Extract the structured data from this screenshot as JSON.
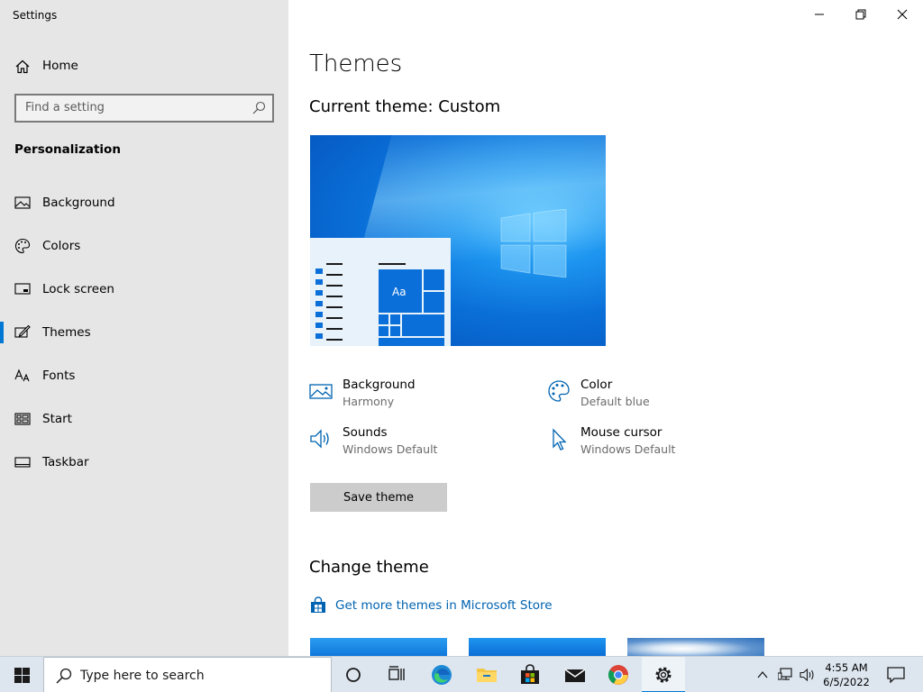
{
  "window": {
    "title": "Settings"
  },
  "sidebar": {
    "home_label": "Home",
    "search_placeholder": "Find a setting",
    "section": "Personalization",
    "items": [
      {
        "label": "Background",
        "icon": "picture-icon"
      },
      {
        "label": "Colors",
        "icon": "palette-icon"
      },
      {
        "label": "Lock screen",
        "icon": "monitor-icon"
      },
      {
        "label": "Themes",
        "icon": "pen-monitor-icon",
        "active": true
      },
      {
        "label": "Fonts",
        "icon": "font-icon"
      },
      {
        "label": "Start",
        "icon": "start-tiles-icon"
      },
      {
        "label": "Taskbar",
        "icon": "taskbar-icon"
      }
    ]
  },
  "main": {
    "title": "Themes",
    "current_theme": "Current theme: Custom",
    "properties": [
      {
        "name": "Background",
        "value": "Harmony",
        "icon": "picture-icon"
      },
      {
        "name": "Color",
        "value": "Default blue",
        "icon": "palette-icon"
      },
      {
        "name": "Sounds",
        "value": "Windows Default",
        "icon": "speaker-icon"
      },
      {
        "name": "Mouse cursor",
        "value": "Windows Default",
        "icon": "cursor-icon"
      }
    ],
    "preview_tile_label": "Aa",
    "save_button": "Save theme",
    "change_theme_title": "Change theme",
    "store_link": "Get more themes in Microsoft Store"
  },
  "taskbar": {
    "search_placeholder": "Type here to search",
    "apps": [
      "cortana-icon",
      "task-view-icon",
      "edge-icon",
      "file-explorer-icon",
      "microsoft-store-icon",
      "mail-icon",
      "chrome-icon",
      "settings-icon"
    ],
    "time": "4:55 AM",
    "date": "6/5/2022"
  },
  "colors": {
    "accent": "#0078d4",
    "sidebar_bg": "#e6e6e6",
    "link": "#0063b1"
  }
}
